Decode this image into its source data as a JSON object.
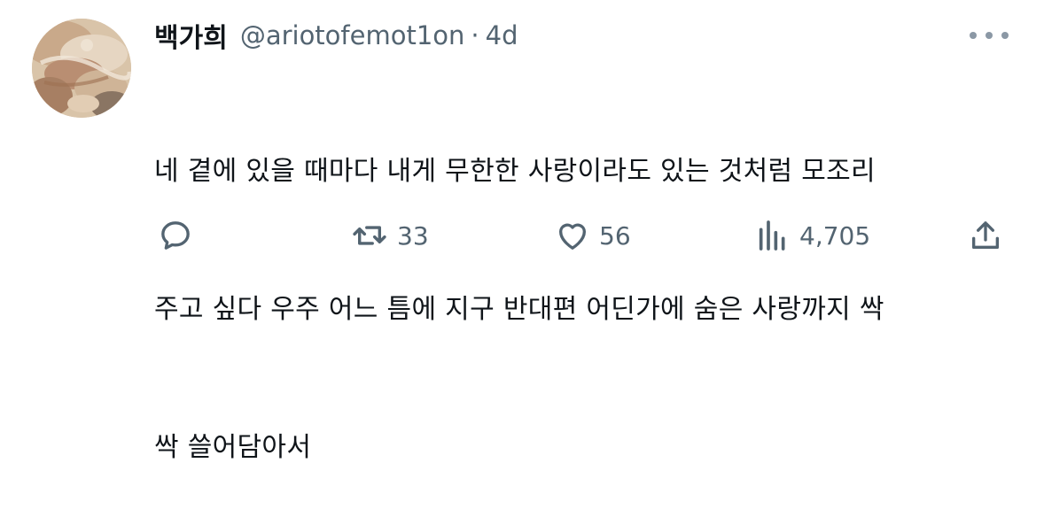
{
  "tweet": {
    "display_name": "백가희",
    "handle": "@ariotofemot1on",
    "separator": "·",
    "time": "4d",
    "text_lines": [
      "네 곁에 있을 때마다 내게 무한한 사랑이라도 있는 것처럼 모조리",
      "주고 싶다 우주 어느 틈에 지구 반대편 어딘가에 숨은 사랑까지 싹",
      "싹 쓸어담아서"
    ]
  },
  "actions": {
    "reply": {
      "icon": "reply-icon",
      "count": ""
    },
    "retweet": {
      "icon": "retweet-icon",
      "count": "33"
    },
    "like": {
      "icon": "heart-icon",
      "count": "56"
    },
    "views": {
      "icon": "views-chart-icon",
      "count": "4,705"
    },
    "share": {
      "icon": "share-icon"
    }
  },
  "colors": {
    "text_primary": "#0f1419",
    "text_secondary": "#536471",
    "background": "#ffffff"
  }
}
